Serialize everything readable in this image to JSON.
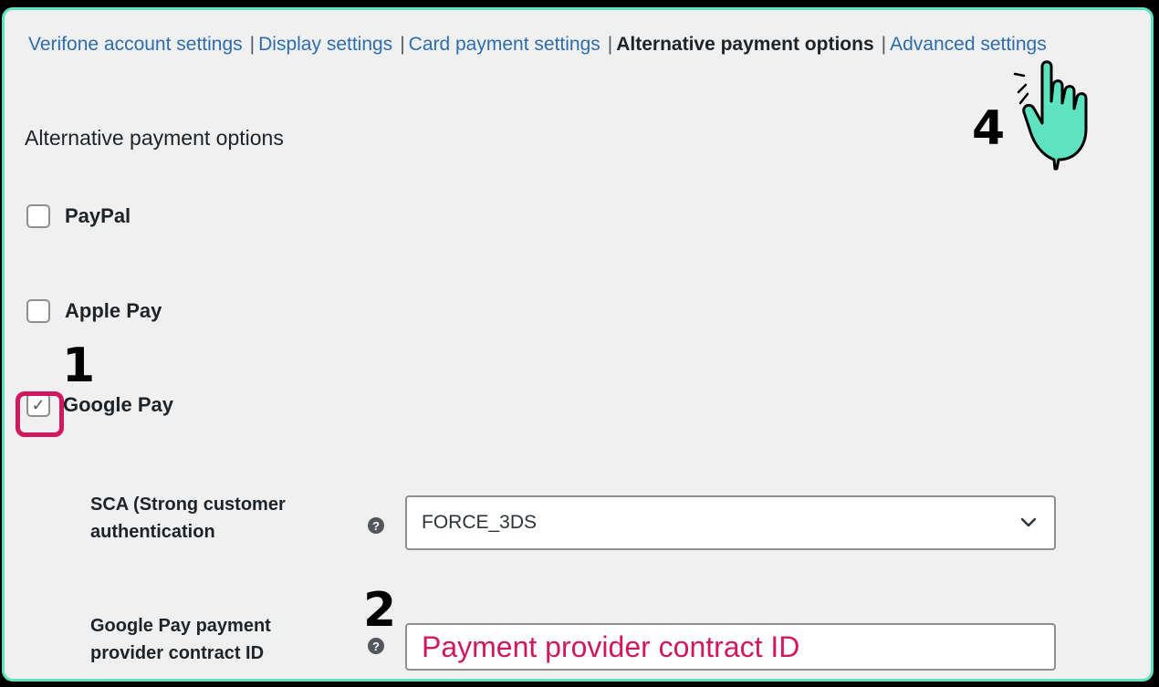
{
  "tabs": [
    {
      "label": "Verifone account settings",
      "active": false
    },
    {
      "label": "Display settings",
      "active": false
    },
    {
      "label": "Card payment settings",
      "active": false
    },
    {
      "label": "Alternative payment options",
      "active": true
    },
    {
      "label": "Advanced settings",
      "active": false
    }
  ],
  "section_title": "Alternative payment options",
  "options": {
    "paypal": {
      "label": "PayPal",
      "checked": false
    },
    "applepay": {
      "label": "Apple Pay",
      "checked": false
    },
    "googlepay": {
      "label": "Google Pay",
      "checked": true
    }
  },
  "sca": {
    "label_line1": "SCA (Strong customer",
    "label_line2": "authentication",
    "value": "FORCE_3DS"
  },
  "contract": {
    "label_line1": "Google Pay payment",
    "label_line2": "provider contract ID",
    "placeholder": "Payment provider contract ID"
  },
  "callouts": {
    "one": "1",
    "two": "2",
    "four": "4"
  },
  "help_glyph": "?",
  "check_glyph": "✓",
  "colors": {
    "frame": "#5de3c0",
    "highlight": "#d0175f",
    "link": "#2c6db0",
    "hand": "#5de3c0"
  },
  "icons": [
    "help-icon",
    "chevron-down-icon",
    "checkmark-icon",
    "hand-pointer-icon"
  ]
}
